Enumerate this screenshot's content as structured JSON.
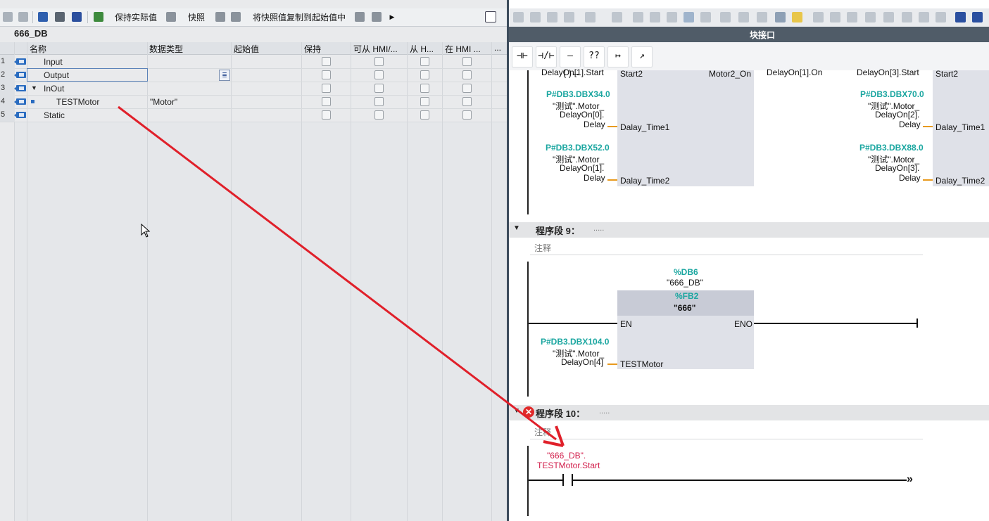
{
  "left_toolbar": {
    "keep_actual": "保持实际值",
    "snapshot": "快照",
    "copy_snapshot": "将快照值复制到起始值中"
  },
  "db_name": "666_DB",
  "table": {
    "headers": [
      "名称",
      "数据类型",
      "起始值",
      "保持",
      "可从 HMI/...",
      "从 H...",
      "在 HMI ...",
      "..."
    ],
    "rows": [
      {
        "n": "1",
        "name": "Input",
        "type": "",
        "start": ""
      },
      {
        "n": "2",
        "name": "Output",
        "type": "",
        "start": ""
      },
      {
        "n": "3",
        "name": "InOut",
        "type": "",
        "start": ""
      },
      {
        "n": "4",
        "name": "TESTMotor",
        "type": "\"Motor\"",
        "start": ""
      },
      {
        "n": "5",
        "name": "Static",
        "type": "",
        "start": ""
      }
    ]
  },
  "right": {
    "interface_bar": "块接口",
    "ladder_buttons": [
      "⊣⊢",
      "⊣/⊢",
      "–()–",
      "??",
      "↦",
      "↗"
    ],
    "seg_top": {
      "in_top_left": "DelayOn[1].Start",
      "pin_start2": "Start2",
      "out_motor2": "Motor2_On",
      "right_top": "DelayOn[1].On",
      "right_top2": "DelayOn[3].Start",
      "pin_start2_r": "Start2",
      "addr1": "P#DB3.DBX34.0",
      "addr1_l1": "\"测试\".Motor_",
      "addr1_l2": "DelayOn[0].",
      "addr1_l3": "Delay",
      "pin1": "Dalay_Time1",
      "addr2": "P#DB3.DBX52.0",
      "addr2_l1": "\"测试\".Motor_",
      "addr2_l2": "DelayOn[1].",
      "addr2_l3": "Delay",
      "pin2": "Dalay_Time2",
      "addr3": "P#DB3.DBX70.0",
      "addr3_l1": "\"测试\".Motor_",
      "addr3_l2": "DelayOn[2].",
      "addr3_l3": "Delay",
      "pin3": "Dalay_Time1",
      "addr4": "P#DB3.DBX88.0",
      "addr4_l1": "\"测试\".Motor_",
      "addr4_l2": "DelayOn[3].",
      "addr4_l3": "Delay",
      "pin4": "Dalay_Time2"
    },
    "seg9": {
      "title": "程序段 9：",
      "dots": ".....",
      "note": "注释",
      "db_addr": "%DB6",
      "db_name": "\"666_DB\"",
      "fb_addr": "%FB2",
      "fb_name": "\"666\"",
      "en": "EN",
      "eno": "ENO",
      "param_addr": "P#DB3.DBX104.0",
      "param_l1": "\"测试\".Motor_",
      "param_l2": "DelayOn[4]",
      "param_pin": "TESTMotor"
    },
    "seg10": {
      "title": "程序段 10：",
      "dots": ".....",
      "note": "注释",
      "contact_l1": "\"666_DB\".",
      "contact_l2": "TESTMotor.Start"
    }
  },
  "colors": {
    "teal": "#1aa6a0",
    "arrow_red": "#e0202a",
    "error_red": "#e02a2a"
  }
}
